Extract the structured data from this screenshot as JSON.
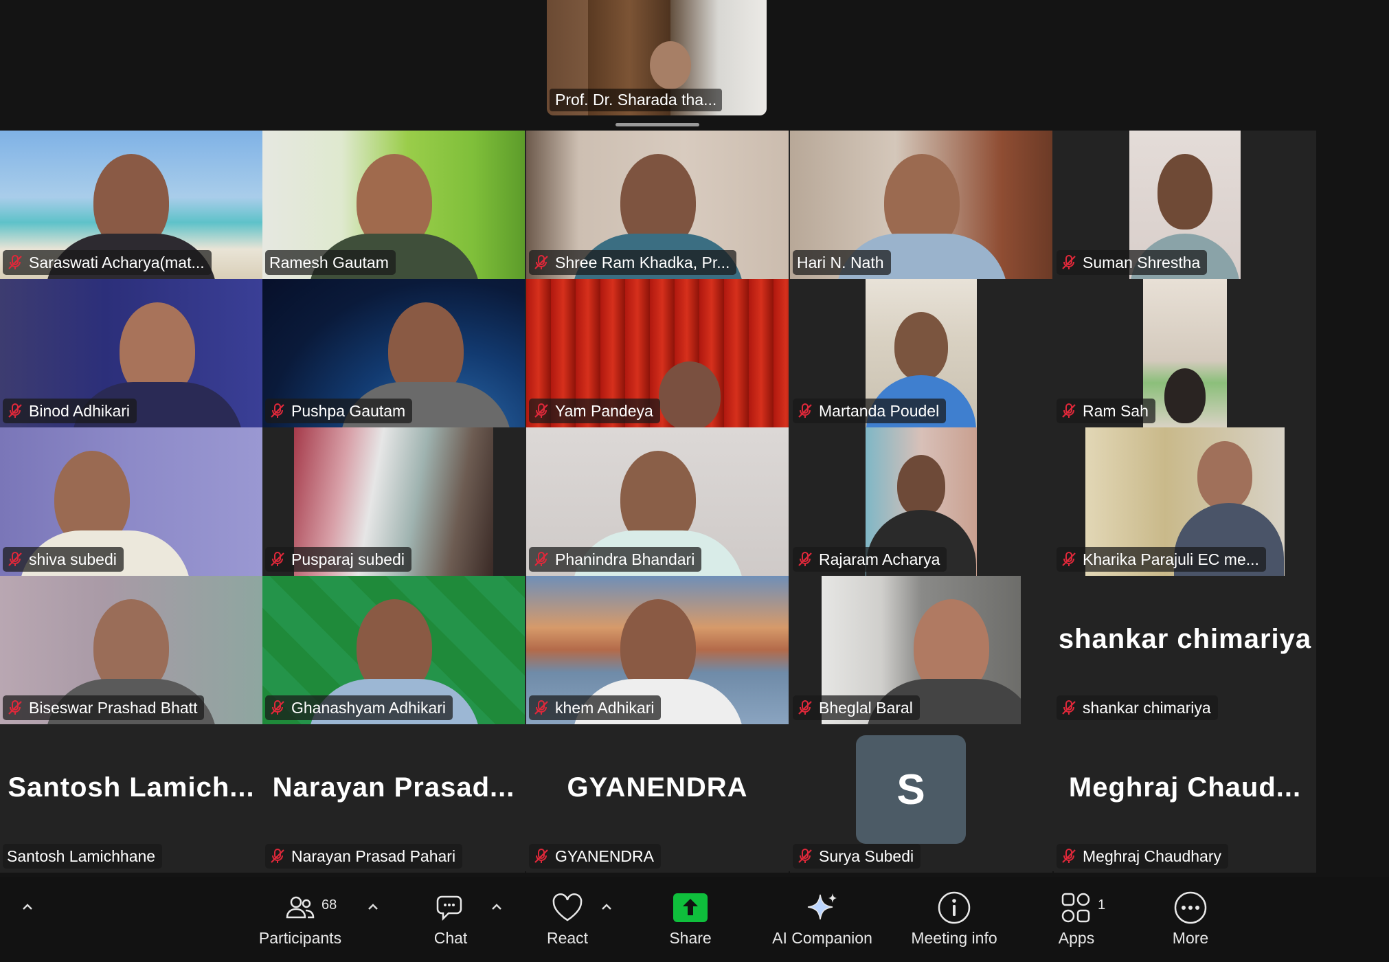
{
  "speaker": {
    "name": "Prof. Dr. Sharada tha..."
  },
  "tiles": [
    {
      "label": "Saraswati Acharya(mat...",
      "muted": true
    },
    {
      "label": "Ramesh Gautam",
      "muted": false
    },
    {
      "label": "Shree Ram Khadka, Pr...",
      "muted": true
    },
    {
      "label": "Hari N. Nath",
      "muted": false
    },
    {
      "label": "Suman Shrestha",
      "muted": true
    },
    {
      "label": "Binod Adhikari",
      "muted": true
    },
    {
      "label": "Pushpa Gautam",
      "muted": true
    },
    {
      "label": "Yam Pandeya",
      "muted": true
    },
    {
      "label": "Martanda Poudel",
      "muted": true
    },
    {
      "label": "Ram Sah",
      "muted": true
    },
    {
      "label": "shiva subedi",
      "muted": true
    },
    {
      "label": "Pusparaj subedi",
      "muted": true
    },
    {
      "label": "Phanindra Bhandari",
      "muted": true
    },
    {
      "label": "Rajaram Acharya",
      "muted": true
    },
    {
      "label": "Kharika Parajuli EC me...",
      "muted": true
    },
    {
      "label": "Biseswar Prashad Bhatt",
      "muted": true
    },
    {
      "label": "Ghanashyam Adhikari",
      "muted": true
    },
    {
      "label": "khem Adhikari",
      "muted": true
    },
    {
      "label": "Bheglal Baral",
      "muted": true
    },
    {
      "label": "shankar chimariya",
      "muted": true,
      "bigname": "shankar chimariya"
    },
    {
      "label": "Santosh Lamichhane",
      "muted": false,
      "bigname": "Santosh  Lamich..."
    },
    {
      "label": "Narayan Prasad Pahari",
      "muted": true,
      "bigname": "Narayan  Prasad..."
    },
    {
      "label": "GYANENDRA",
      "muted": true,
      "bigname": "GYANENDRA"
    },
    {
      "label": "Surya Subedi",
      "muted": true,
      "avatar": "S"
    },
    {
      "label": "Meghraj Chaudhary",
      "muted": true,
      "bigname": "Meghraj  Chaud..."
    }
  ],
  "toolbar": {
    "participants_label": "Participants",
    "participants_count": "68",
    "chat_label": "Chat",
    "react_label": "React",
    "share_label": "Share",
    "ai_label": "AI Companion",
    "info_label": "Meeting info",
    "apps_label": "Apps",
    "apps_count": "1",
    "more_label": "More"
  },
  "colors": {
    "share_green": "#0fbf3c",
    "mic_muted": "#e0283a"
  }
}
